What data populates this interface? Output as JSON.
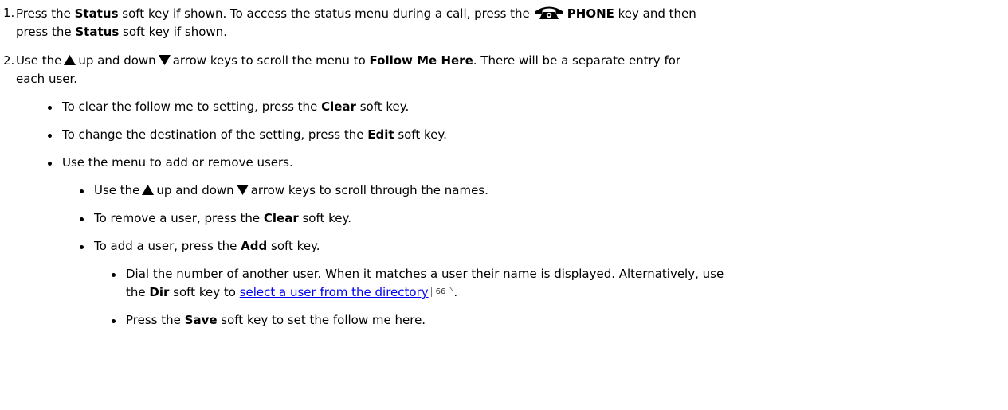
{
  "steps": [
    {
      "num": "1.",
      "t1": "Press the ",
      "b1": "Status",
      "t2": " soft key if shown. To access the status menu during a call, press the",
      "b2": "PHONE",
      "t3": " key and then",
      "t4": "press the ",
      "b3": "Status",
      "t5": " soft key if shown."
    },
    {
      "num": "2.",
      "t1": "Use the",
      "t2": "up and down",
      "t3": "arrow keys to scroll the menu to ",
      "b1": "Follow Me Here",
      "t4": ". There will be a separate entry for",
      "t5": "each user."
    }
  ],
  "bullets": {
    "clear": {
      "t1": "To clear the follow me to setting, press the ",
      "b": "Clear",
      "t2": " soft key."
    },
    "edit": {
      "t1": "To change the destination of the setting, press the ",
      "b": "Edit",
      "t2": " soft key."
    },
    "menu": {
      "t": "Use the menu to add or remove users."
    },
    "scroll": {
      "t1": "Use the",
      "t2": "up and down",
      "t3": "arrow keys to scroll through the names."
    },
    "remove": {
      "t1": "To remove a user, press the ",
      "b": "Clear",
      "t2": " soft key."
    },
    "add": {
      "t1": "To add a user, press the ",
      "b": "Add",
      "t2": " soft key."
    },
    "dial": {
      "t1": "Dial the number of another user. When it matches a user their name is displayed.  Alternatively, use",
      "t2": "the ",
      "b": "Dir",
      "t3": " soft key to ",
      "link": "select a user from the directory",
      "page": "66",
      "t4": "."
    },
    "save": {
      "t1": "Press the ",
      "b": "Save",
      "t2": " soft key to set the follow me here."
    }
  },
  "icons": {
    "phone": "phone-key-icon",
    "up": "up-arrow-icon",
    "down": "down-arrow-icon",
    "link_marker": "page-reference-icon"
  },
  "colors": {
    "text": "#000000",
    "link": "#0000ee"
  }
}
